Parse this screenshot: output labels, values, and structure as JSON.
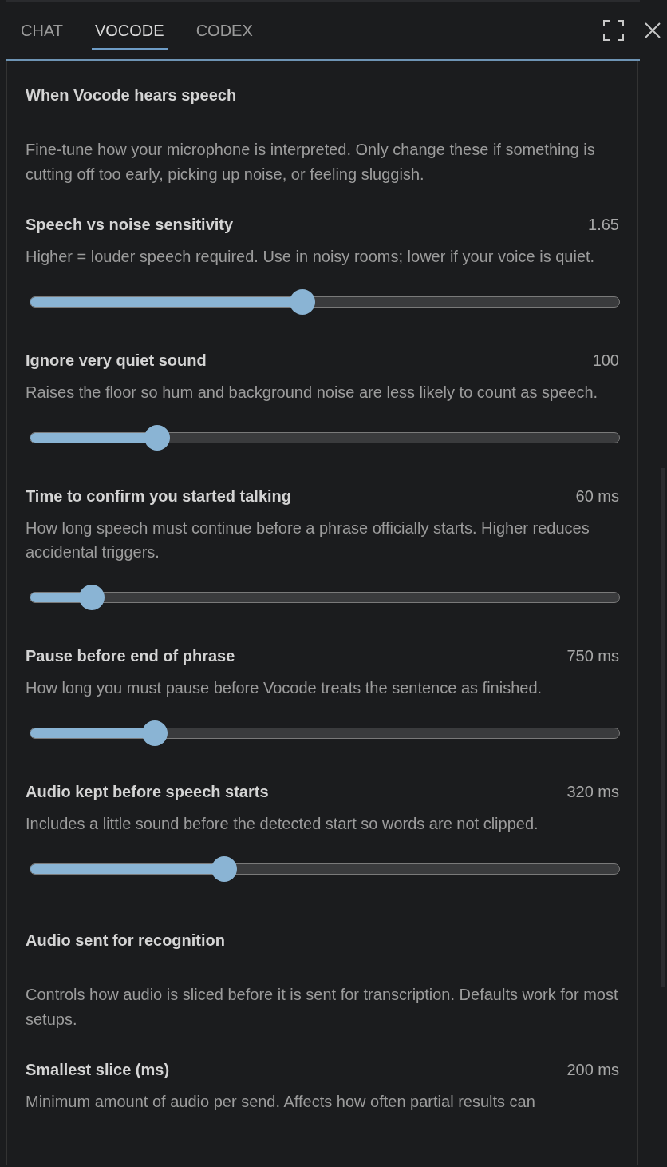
{
  "tabs": [
    {
      "label": "CHAT",
      "selected": false
    },
    {
      "label": "VOCODE",
      "selected": true
    },
    {
      "label": "CODEX",
      "selected": false
    }
  ],
  "sections": [
    {
      "heading": "When Vocode hears speech",
      "description": "Fine-tune how your microphone is interpreted. Only change these if something is cutting off too early, picking up noise, or feeling sluggish.",
      "settings": [
        {
          "title": "Speech vs noise sensitivity",
          "value": "1.65",
          "description": "Higher = louder speech required. Use in noisy rooms; lower if your voice is quiet.",
          "level": 0.462
        },
        {
          "title": "Ignore very quiet sound",
          "value": "100",
          "description": "Raises the floor so hum and background noise are less likely to count as speech.",
          "level": 0.211
        },
        {
          "title": "Time to confirm you started talking",
          "value": "60 ms",
          "description": "How long speech must continue before a phrase officially starts. Higher reduces accidental triggers.",
          "level": 0.099
        },
        {
          "title": "Pause before end of phrase",
          "value": "750 ms",
          "description": "How long you must pause before Vocode treats the sentence as finished.",
          "level": 0.208
        },
        {
          "title": "Audio kept before speech starts",
          "value": "320 ms",
          "description": "Includes a little sound before the detected start so words are not clipped.",
          "level": 0.327
        }
      ]
    },
    {
      "heading": "Audio sent for recognition",
      "description": "Controls how audio is sliced before it is sent for transcription. Defaults work for most setups.",
      "settings": [
        {
          "title": "Smallest slice (ms)",
          "value": "200 ms",
          "description": "Minimum amount of audio per send. Affects how often partial results can"
        }
      ]
    }
  ]
}
